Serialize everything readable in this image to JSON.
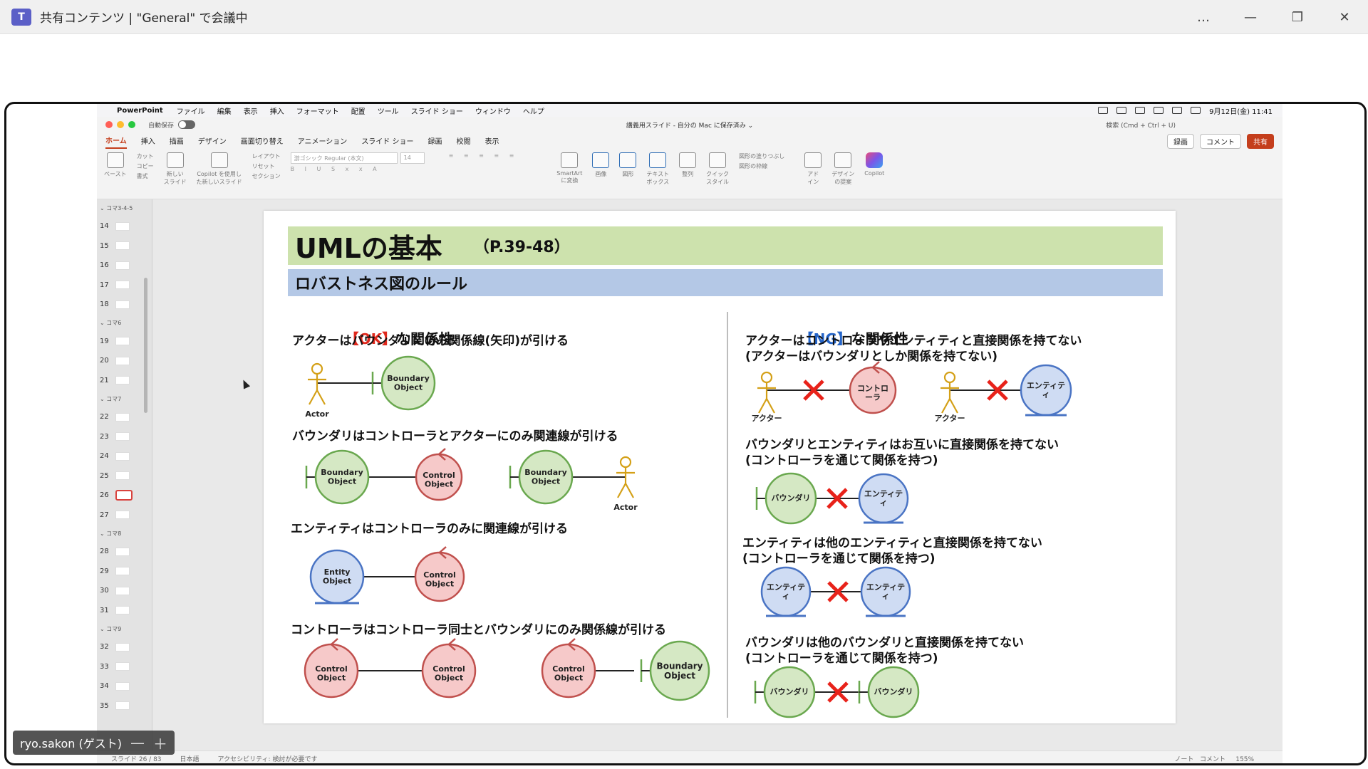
{
  "teams": {
    "title": "共有コンテンツ | \"General\" で会議中",
    "logo": "T",
    "more": "…",
    "minimize": "—",
    "restore": "❐",
    "close": "✕"
  },
  "menubar": {
    "app": "PowerPoint",
    "items": [
      "ファイル",
      "編集",
      "表示",
      "挿入",
      "フォーマット",
      "配置",
      "ツール",
      "スライド ショー",
      "ウィンドウ",
      "ヘルプ"
    ],
    "datetime": "9月12日(金) 11:41"
  },
  "titlebar": {
    "autosave": "自動保存",
    "doc_title": "講義用スライド - 自分の Mac に保存済み ⌄",
    "search": "検索 (Cmd + Ctrl + U)"
  },
  "tabs": [
    "ホーム",
    "挿入",
    "描画",
    "デザイン",
    "画面切り替え",
    "アニメーション",
    "スライド ショー",
    "録画",
    "校閲",
    "表示"
  ],
  "tab_buttons": {
    "record": "録画",
    "comment": "コメント",
    "share": "共有"
  },
  "ribbon": {
    "paste": "ペースト",
    "cut": "カット",
    "copy": "コピー",
    "format": "書式",
    "new_slide": "新しい\nスライド",
    "copilot_new": "Copilot を使用し\nた新しいスライド",
    "layout": "レイアウト",
    "reset": "リセット",
    "section": "セクション",
    "font": "游ゴシック Regular (本文)",
    "size": "14",
    "smartart": "SmartArt\nに変換",
    "picture": "画像",
    "shapes": "図形",
    "textbox": "テキスト\nボックス",
    "arrange": "整列",
    "quick_style": "クイック\nスタイル",
    "fill": "図形の塗りつぶし",
    "outline": "図形の枠線",
    "addin": "アド\nイン",
    "design": "デザイン\nの提案",
    "copilot": "Copilot"
  },
  "thumbnails": {
    "sections": [
      {
        "label": "コマ3-4-5",
        "slides": [
          14,
          15,
          16,
          17,
          18
        ]
      },
      {
        "label": "コマ6",
        "slides": [
          19,
          20,
          21
        ]
      },
      {
        "label": "コマ7",
        "slides": [
          22,
          23,
          24,
          25,
          26,
          27
        ]
      },
      {
        "label": "コマ8",
        "slides": [
          28,
          29,
          30,
          31
        ]
      },
      {
        "label": "コマ9",
        "slides": [
          32,
          33,
          34,
          35
        ]
      }
    ],
    "selected": 26
  },
  "slide": {
    "title": "UMLの基本",
    "pages": "（P.39-48）",
    "subtitle": "ロバストネス図のルール",
    "ok_heading": {
      "mark": "【OK】",
      "text": "な関係性"
    },
    "ng_heading": {
      "mark": "【NG】",
      "text": "な関係性"
    },
    "ok_rules": [
      "アクターはバウンダリにのみ関係線(矢印)が引ける",
      "バウンダリはコントローラとアクターにのみ関連線が引ける",
      "エンティティはコントローラのみに関連線が引ける",
      "コントローラはコントローラ同士とバウンダリにのみ関係線が引ける"
    ],
    "ng_rules": [
      "アクターはコントローラやエンティティと直接関係を持てない\n(アクターはバウンダリとしか関係を持てない)",
      "バウンダリとエンティティはお互いに直接関係を持てない\n(コントローラを通じて関係を持つ)",
      "エンティティは他のエンティティと直接関係を持てない\n(コントローラを通じて関係を持つ)",
      "バウンダリは他のバウンダリと直接関係を持てない\n(コントローラを通じて関係を持つ)"
    ],
    "labels": {
      "actor": "Actor",
      "boundary": "Boundary\nObject",
      "control": "Control\nObject",
      "entity": "Entity\nObject",
      "actor_jp": "アクター",
      "controller_jp": "コントロ\nーラ",
      "entity_jp": "エンティテ\nィ",
      "boundary_jp": "バウンダリ"
    },
    "colors": {
      "title_bg": "#cde2ad",
      "subtitle_bg": "#b4c8e6",
      "boundary_fill": "#d5e8c4",
      "boundary_stroke": "#6aa84f",
      "control_fill": "#f6c9c9",
      "control_stroke": "#c0504d",
      "entity_fill": "#cfdcf3",
      "entity_stroke": "#4a74c4",
      "actor": "#d4a017",
      "cross": "#e8221a"
    }
  },
  "status": {
    "slide": "スライド 26 / 83",
    "lang": "日本語",
    "accessibility": "アクセシビリティ: 検討が必要です",
    "notes": "ノート",
    "comments": "コメント",
    "zoom": "155%"
  },
  "participant": {
    "name": "ryo.sakon (ゲスト)",
    "minus": "—",
    "plus": "＋"
  }
}
